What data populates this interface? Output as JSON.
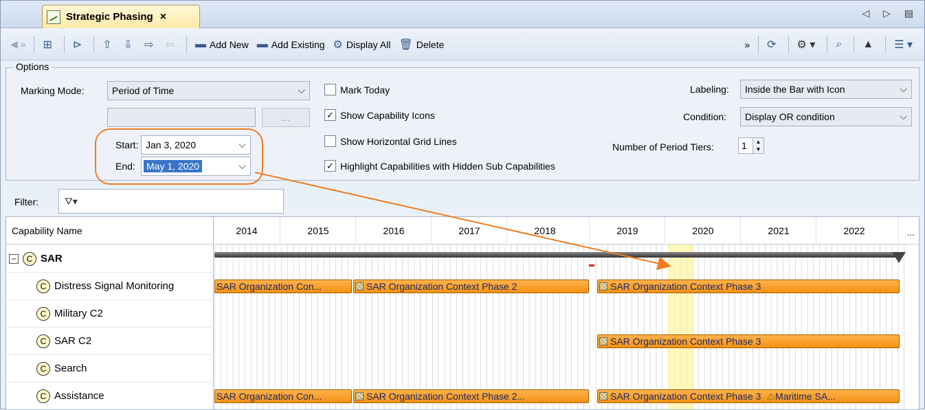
{
  "tab": {
    "title": "Strategic Phasing",
    "close": "×",
    "nav": "◁ ▷ ▤"
  },
  "toolbar": {
    "add_new": "Add New",
    "add_existing": "Add Existing",
    "display_all": "Display All",
    "delete": "Delete"
  },
  "options": {
    "legend": "Options",
    "marking_mode_label": "Marking Mode:",
    "marking_mode_value": "Period of Time",
    "dots": "...",
    "start_label": "Start:",
    "start_value": "Jan 3, 2020",
    "end_label": "End:",
    "end_value": "May 1, 2020",
    "mark_today": "Mark Today",
    "show_capability_icons": "Show Capability Icons",
    "show_grid_lines": "Show Horizontal Grid Lines",
    "highlight_hidden": "Highlight Capabilities with Hidden Sub Capabilities",
    "labeling_label": "Labeling:",
    "labeling_value": "Inside the Bar with Icon",
    "condition_label": "Condition:",
    "condition_value": "Display OR condition",
    "tiers_label": "Number of Period Tiers:",
    "tiers_value": "1"
  },
  "checks": {
    "mark_today": false,
    "show_capability_icons": true,
    "show_grid_lines": false,
    "highlight_hidden": true
  },
  "filter": {
    "label": "Filter:"
  },
  "table": {
    "name_header": "Capability Name",
    "years": [
      "2014",
      "2015",
      "2016",
      "2017",
      "2018",
      "2019",
      "2020",
      "2021",
      "2022"
    ],
    "more": "...",
    "rows": [
      {
        "name": "SAR",
        "bold": true
      },
      {
        "name": "Distress Signal Monitoring"
      },
      {
        "name": "Military C2"
      },
      {
        "name": "SAR C2"
      },
      {
        "name": "Search"
      },
      {
        "name": "Assistance"
      }
    ],
    "bars": {
      "dsm_1": "SAR Organization Con...",
      "dsm_2": "SAR Organization Context Phase 2",
      "dsm_3": "SAR Organization Context Phase 3",
      "sarc2_3": "SAR Organization Context Phase 3",
      "asst_1": "SAR Organization Con...",
      "asst_2": "SAR Organization Context Phase 2...",
      "asst_3": "SAR Organization Context Phase 3",
      "asst_4": "Maritime SA..."
    }
  },
  "colors": {
    "bar": "#f49214",
    "highlight": "#fff5a0",
    "annotation": "#ef7d22"
  }
}
